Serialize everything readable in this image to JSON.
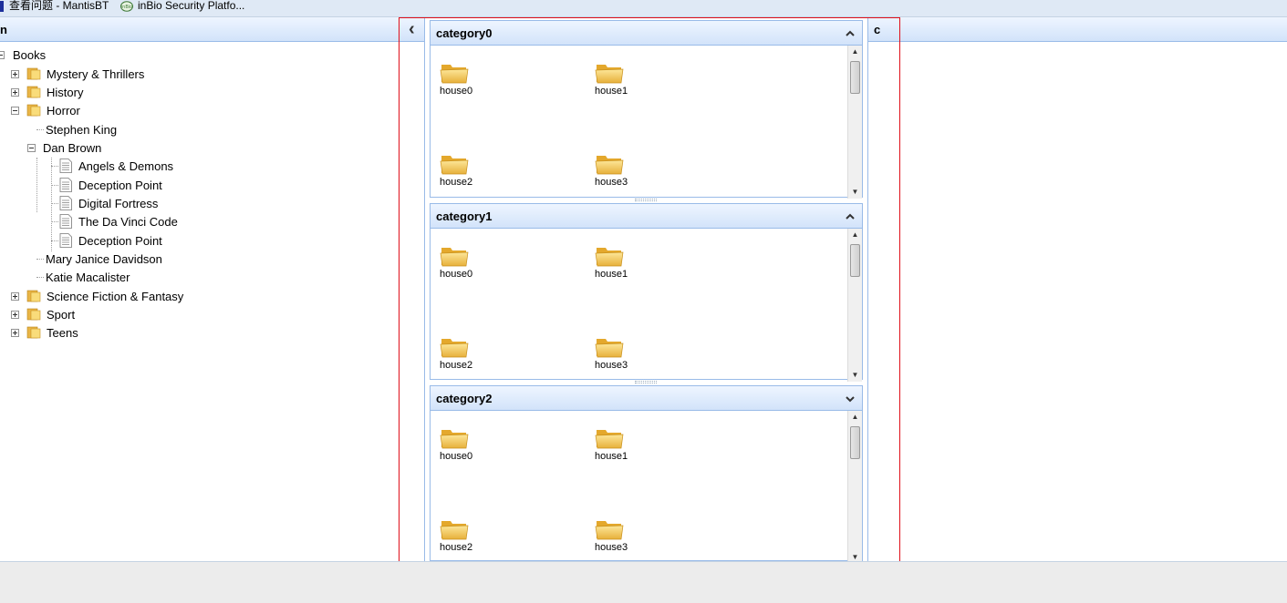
{
  "bookmarks": {
    "item1": "查看问题 - MantisBT",
    "item2": "inBio Security Platfo..."
  },
  "left_panel": {
    "title": "n",
    "tree": {
      "root": "Books",
      "cat1": "Mystery & Thrillers",
      "cat2": "History",
      "cat3": "Horror",
      "author1": "Stephen King",
      "author2": "Dan Brown",
      "book1": "Angels & Demons",
      "book2": "Deception Point",
      "book3": "Digital Fortress",
      "book4": "The Da Vinci Code",
      "book5": "Deception Point",
      "author3": "Mary Janice Davidson",
      "author4": "Katie Macalister",
      "cat4": "Science Fiction & Fantasy",
      "cat5": "Sport",
      "cat6": "Teens"
    }
  },
  "collapse_button": {
    "icon": "chevron-left-icon",
    "glyph": "‹"
  },
  "accordion": [
    {
      "title": "category0",
      "toggle_icon": "chevron-up-icon",
      "items": [
        "house0",
        "house1",
        "house2",
        "house3"
      ]
    },
    {
      "title": "category1",
      "toggle_icon": "chevron-up-icon",
      "items": [
        "house0",
        "house1",
        "house2",
        "house3"
      ]
    },
    {
      "title": "category2",
      "toggle_icon": "chevron-down-icon",
      "items": [
        "house0",
        "house1",
        "house2",
        "house3"
      ]
    }
  ],
  "right_panel": {
    "title": "c"
  },
  "colors": {
    "header_border": "#99bbe8",
    "header_text": "#15428b",
    "highlight": "#e0101a"
  }
}
